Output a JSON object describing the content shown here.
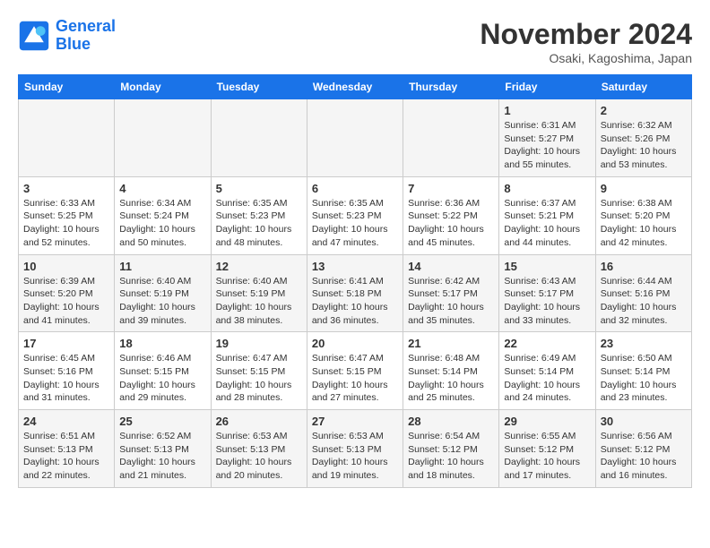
{
  "header": {
    "logo_line1": "General",
    "logo_line2": "Blue",
    "month": "November 2024",
    "location": "Osaki, Kagoshima, Japan"
  },
  "days_of_week": [
    "Sunday",
    "Monday",
    "Tuesday",
    "Wednesday",
    "Thursday",
    "Friday",
    "Saturday"
  ],
  "weeks": [
    [
      {
        "day": "",
        "info": ""
      },
      {
        "day": "",
        "info": ""
      },
      {
        "day": "",
        "info": ""
      },
      {
        "day": "",
        "info": ""
      },
      {
        "day": "",
        "info": ""
      },
      {
        "day": "1",
        "info": "Sunrise: 6:31 AM\nSunset: 5:27 PM\nDaylight: 10 hours and 55 minutes."
      },
      {
        "day": "2",
        "info": "Sunrise: 6:32 AM\nSunset: 5:26 PM\nDaylight: 10 hours and 53 minutes."
      }
    ],
    [
      {
        "day": "3",
        "info": "Sunrise: 6:33 AM\nSunset: 5:25 PM\nDaylight: 10 hours and 52 minutes."
      },
      {
        "day": "4",
        "info": "Sunrise: 6:34 AM\nSunset: 5:24 PM\nDaylight: 10 hours and 50 minutes."
      },
      {
        "day": "5",
        "info": "Sunrise: 6:35 AM\nSunset: 5:23 PM\nDaylight: 10 hours and 48 minutes."
      },
      {
        "day": "6",
        "info": "Sunrise: 6:35 AM\nSunset: 5:23 PM\nDaylight: 10 hours and 47 minutes."
      },
      {
        "day": "7",
        "info": "Sunrise: 6:36 AM\nSunset: 5:22 PM\nDaylight: 10 hours and 45 minutes."
      },
      {
        "day": "8",
        "info": "Sunrise: 6:37 AM\nSunset: 5:21 PM\nDaylight: 10 hours and 44 minutes."
      },
      {
        "day": "9",
        "info": "Sunrise: 6:38 AM\nSunset: 5:20 PM\nDaylight: 10 hours and 42 minutes."
      }
    ],
    [
      {
        "day": "10",
        "info": "Sunrise: 6:39 AM\nSunset: 5:20 PM\nDaylight: 10 hours and 41 minutes."
      },
      {
        "day": "11",
        "info": "Sunrise: 6:40 AM\nSunset: 5:19 PM\nDaylight: 10 hours and 39 minutes."
      },
      {
        "day": "12",
        "info": "Sunrise: 6:40 AM\nSunset: 5:19 PM\nDaylight: 10 hours and 38 minutes."
      },
      {
        "day": "13",
        "info": "Sunrise: 6:41 AM\nSunset: 5:18 PM\nDaylight: 10 hours and 36 minutes."
      },
      {
        "day": "14",
        "info": "Sunrise: 6:42 AM\nSunset: 5:17 PM\nDaylight: 10 hours and 35 minutes."
      },
      {
        "day": "15",
        "info": "Sunrise: 6:43 AM\nSunset: 5:17 PM\nDaylight: 10 hours and 33 minutes."
      },
      {
        "day": "16",
        "info": "Sunrise: 6:44 AM\nSunset: 5:16 PM\nDaylight: 10 hours and 32 minutes."
      }
    ],
    [
      {
        "day": "17",
        "info": "Sunrise: 6:45 AM\nSunset: 5:16 PM\nDaylight: 10 hours and 31 minutes."
      },
      {
        "day": "18",
        "info": "Sunrise: 6:46 AM\nSunset: 5:15 PM\nDaylight: 10 hours and 29 minutes."
      },
      {
        "day": "19",
        "info": "Sunrise: 6:47 AM\nSunset: 5:15 PM\nDaylight: 10 hours and 28 minutes."
      },
      {
        "day": "20",
        "info": "Sunrise: 6:47 AM\nSunset: 5:15 PM\nDaylight: 10 hours and 27 minutes."
      },
      {
        "day": "21",
        "info": "Sunrise: 6:48 AM\nSunset: 5:14 PM\nDaylight: 10 hours and 25 minutes."
      },
      {
        "day": "22",
        "info": "Sunrise: 6:49 AM\nSunset: 5:14 PM\nDaylight: 10 hours and 24 minutes."
      },
      {
        "day": "23",
        "info": "Sunrise: 6:50 AM\nSunset: 5:14 PM\nDaylight: 10 hours and 23 minutes."
      }
    ],
    [
      {
        "day": "24",
        "info": "Sunrise: 6:51 AM\nSunset: 5:13 PM\nDaylight: 10 hours and 22 minutes."
      },
      {
        "day": "25",
        "info": "Sunrise: 6:52 AM\nSunset: 5:13 PM\nDaylight: 10 hours and 21 minutes."
      },
      {
        "day": "26",
        "info": "Sunrise: 6:53 AM\nSunset: 5:13 PM\nDaylight: 10 hours and 20 minutes."
      },
      {
        "day": "27",
        "info": "Sunrise: 6:53 AM\nSunset: 5:13 PM\nDaylight: 10 hours and 19 minutes."
      },
      {
        "day": "28",
        "info": "Sunrise: 6:54 AM\nSunset: 5:12 PM\nDaylight: 10 hours and 18 minutes."
      },
      {
        "day": "29",
        "info": "Sunrise: 6:55 AM\nSunset: 5:12 PM\nDaylight: 10 hours and 17 minutes."
      },
      {
        "day": "30",
        "info": "Sunrise: 6:56 AM\nSunset: 5:12 PM\nDaylight: 10 hours and 16 minutes."
      }
    ]
  ]
}
